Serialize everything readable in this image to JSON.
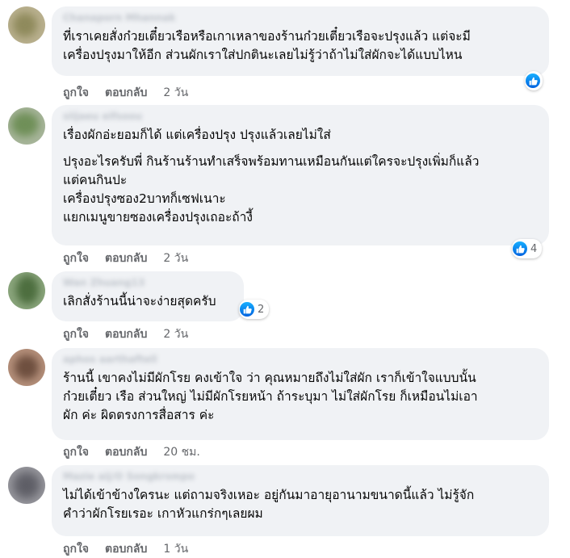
{
  "comments": [
    {
      "author": "Chanaporn Mhannak",
      "lines": [
        "ที่เราเคยสั่งก๋วยเตี๋ยวเรือหรือเกาเหลาของร้านก๋วยเตี๋ยวเรือจะปรุงแล้ว แต่จะมี",
        "เครื่องปรุงมาให้อีก ส่วนผักเราใส่ปกตินะเลยไม่รู้ว่าถ้าไม่ใส่ผักจะได้แบบไหน"
      ],
      "like_label": "ถูกใจ",
      "reply_label": "ตอบกลับ",
      "time": "2 วัน",
      "reaction_count": "",
      "avatar_color": "#9aa078"
    },
    {
      "author": "siijaeu eifsoou",
      "lines": [
        "เรื่องผักอ่ะยอมก็ได้ แต่เครื่องปรุง ปรุงแล้วเลยไม่ใส่",
        "",
        "ปรุงอะไรครับพี่ กินร้านร้านทำเสร็จพร้อมทานเหมือนกันแต่ใครจะปรุงเพิ่มก็แล้ว",
        "แต่คนกินปะ",
        "เครื่องปรุงซอง2บาทก็เซฟเนาะ",
        "แยกเมนูขายซองเครื่องปรุงเถอะถ้างี้"
      ],
      "like_label": "ถูกใจ",
      "reply_label": "ตอบกลับ",
      "time": "2 วัน",
      "reaction_count": "4",
      "avatar_color": "#7f9a6a"
    },
    {
      "author": "Wan Zhuang13",
      "lines": [
        "เลิกสั่งร้านนี้น่าจะง่ายสุดครับ"
      ],
      "like_label": "ถูกใจ",
      "reply_label": "ตอบกลับ",
      "time": "2 วัน",
      "reaction_count": "2",
      "avatar_color": "#5f7e55"
    },
    {
      "author": "aphos aarthaftell",
      "lines": [
        "ร้านนี้ เขาคงไม่มีผักโรย คงเข้าใจ ว่า คุณหมายถึงไม่ใส่ผัก เราก็เข้าใจแบบนั้น",
        "ก๋วยเตี๋ยว เรือ ส่วนใหญ่ ไม่มีผักโรยหน้า ถ้าระบุมา ไม่ใส่ผักโรย ก็เหมือนไม่เอา",
        "ผัก ค่ะ ผิดตรงการสื่อสาร ค่ะ"
      ],
      "like_label": "ถูกใจ",
      "reply_label": "ตอบกลับ",
      "time": "20 ชม.",
      "reaction_count": "",
      "avatar_color": "#8a6a58"
    },
    {
      "author": "Mazie aij/O Songkrsmpo",
      "lines": [
        "ไม่ได้เข้าข้างใครนะ แต่ถามจริงเหอะ อยู่กันมาอายุอานามขนาดนี้แล้ว ไม่รู้จัก",
        "คำว่าผักโรยเรอะ เกาหัวแกร่กๆเลยผม"
      ],
      "like_label": "ถูกใจ",
      "reply_label": "ตอบกลับ",
      "time": "1 วัน",
      "reaction_count": "",
      "avatar_color": "#7a7a80"
    }
  ]
}
